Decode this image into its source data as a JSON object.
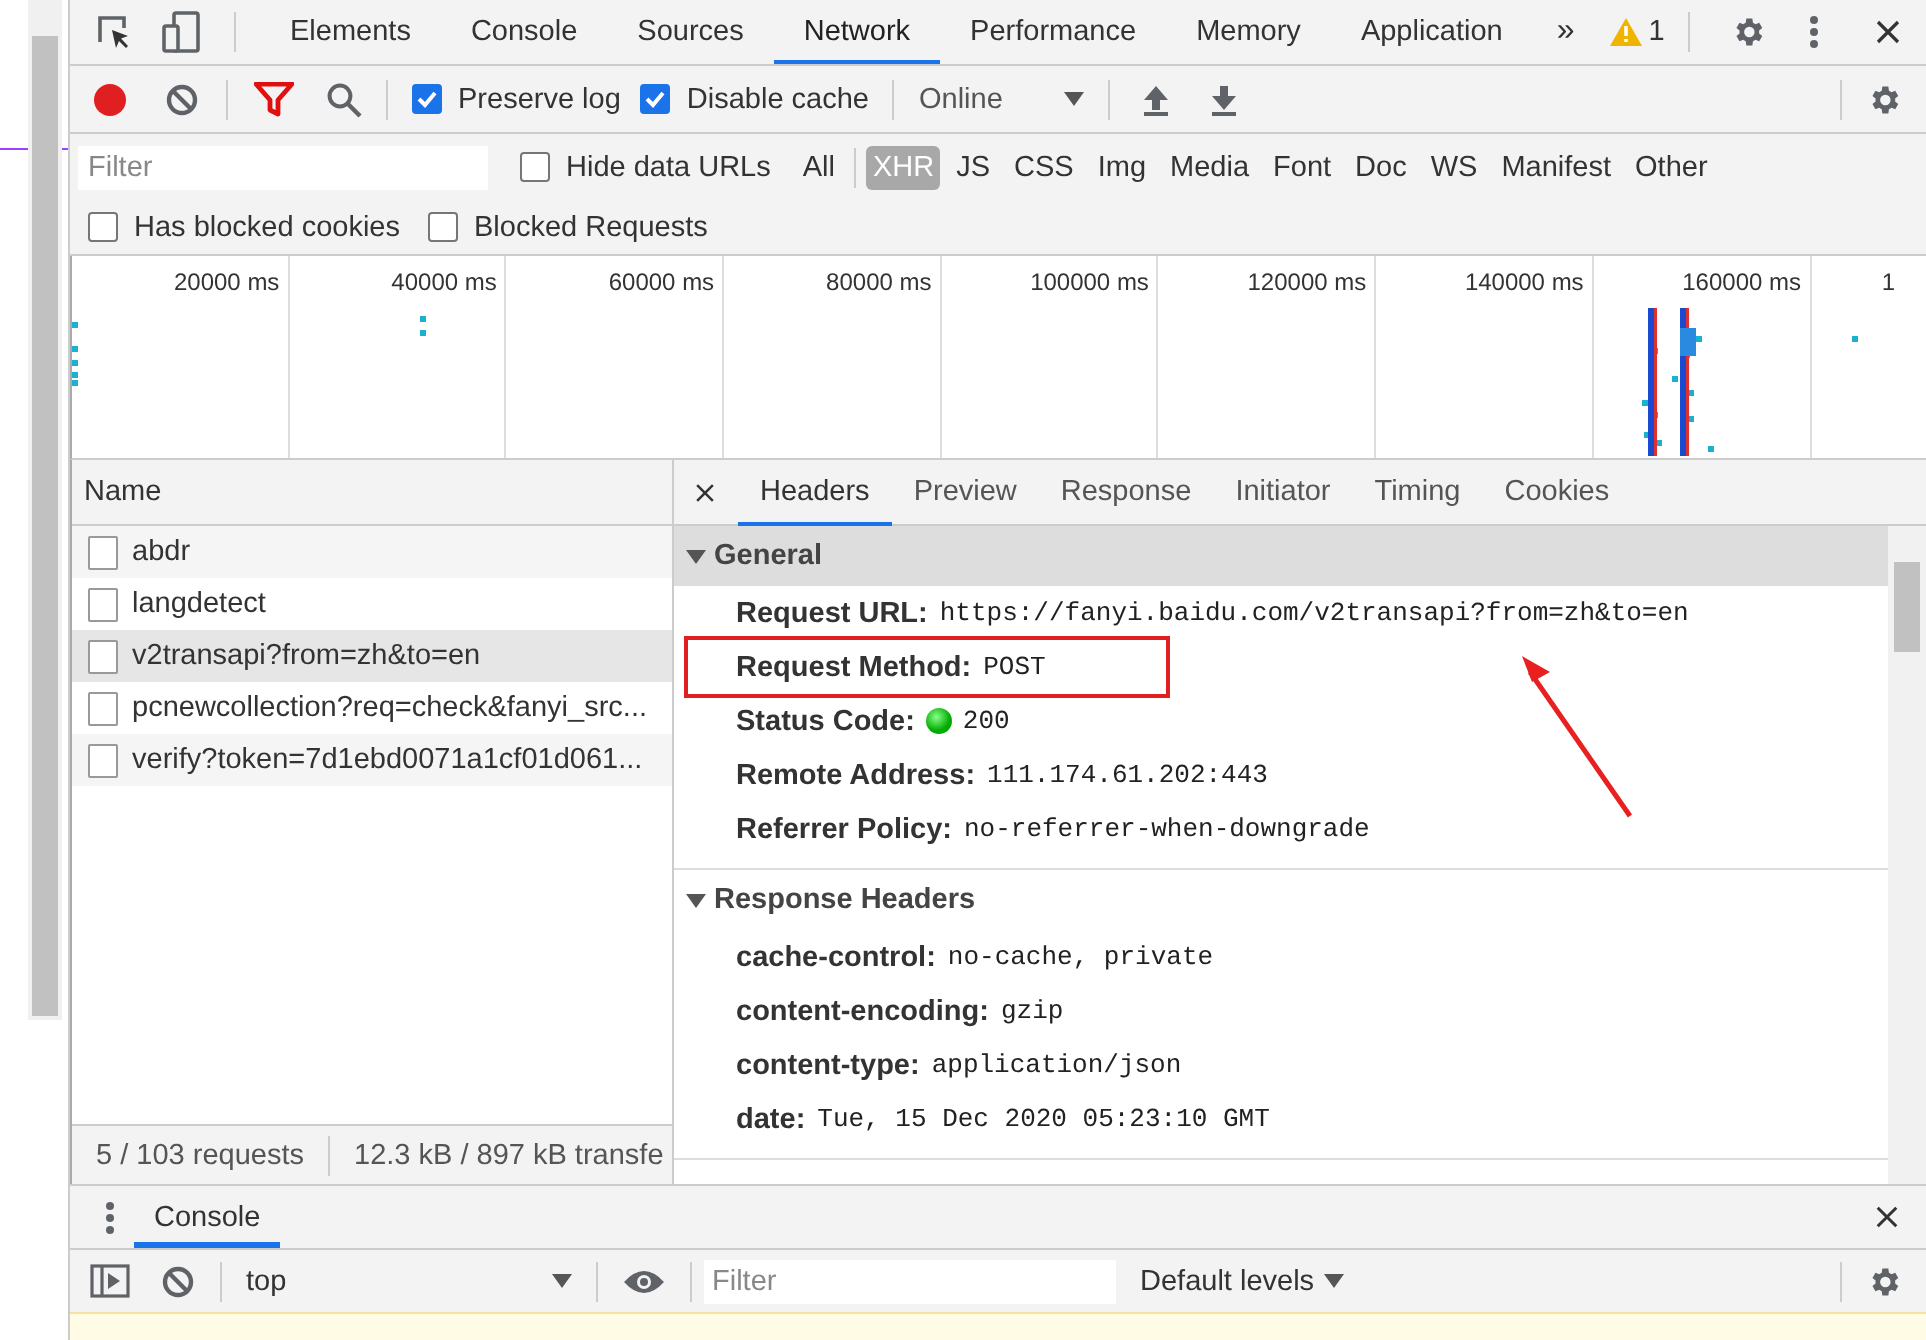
{
  "devtools_tabs": [
    {
      "label": "Elements",
      "selected": false
    },
    {
      "label": "Console",
      "selected": false
    },
    {
      "label": "Sources",
      "selected": false
    },
    {
      "label": "Network",
      "selected": true
    },
    {
      "label": "Performance",
      "selected": false
    },
    {
      "label": "Memory",
      "selected": false
    },
    {
      "label": "Application",
      "selected": false
    }
  ],
  "overflow_tabs": "»",
  "issues": {
    "count": "1"
  },
  "network_toolbar": {
    "recording": true,
    "filter_active": true,
    "options": [
      {
        "label": "Preserve log",
        "checked": true
      },
      {
        "label": "Disable cache",
        "checked": true
      }
    ],
    "throttling": "Online"
  },
  "filter_bar": {
    "placeholder": "Filter",
    "hide_data_urls": {
      "label": "Hide data URLs",
      "checked": false
    },
    "types": [
      {
        "label": "All",
        "selected": false
      },
      {
        "label": "XHR",
        "selected": true
      },
      {
        "label": "JS",
        "selected": false
      },
      {
        "label": "CSS",
        "selected": false
      },
      {
        "label": "Img",
        "selected": false
      },
      {
        "label": "Media",
        "selected": false
      },
      {
        "label": "Font",
        "selected": false
      },
      {
        "label": "Doc",
        "selected": false
      },
      {
        "label": "WS",
        "selected": false
      },
      {
        "label": "Manifest",
        "selected": false
      },
      {
        "label": "Other",
        "selected": false
      }
    ]
  },
  "blocked_filters": [
    {
      "label": "Has blocked cookies",
      "checked": false
    },
    {
      "label": "Blocked Requests",
      "checked": false
    }
  ],
  "overview": {
    "ticks": [
      "20000 ms",
      "40000 ms",
      "60000 ms",
      "80000 ms",
      "100000 ms",
      "120000 ms",
      "140000 ms",
      "160000 ms",
      "1"
    ]
  },
  "requests": {
    "column": "Name",
    "rows": [
      {
        "name": "abdr",
        "selected": false
      },
      {
        "name": "langdetect",
        "selected": false
      },
      {
        "name": "v2transapi?from=zh&to=en",
        "selected": true
      },
      {
        "name": "pcnewcollection?req=check&fanyi_src...",
        "selected": false
      },
      {
        "name": "verify?token=7d1ebd0071a1cf01d061...",
        "selected": false
      }
    ]
  },
  "status_bar": [
    "5 / 103 requests",
    "12.3 kB / 897 kB transfe"
  ],
  "details": {
    "tabs": [
      {
        "label": "Headers",
        "selected": true
      },
      {
        "label": "Preview",
        "selected": false
      },
      {
        "label": "Response",
        "selected": false
      },
      {
        "label": "Initiator",
        "selected": false
      },
      {
        "label": "Timing",
        "selected": false
      },
      {
        "label": "Cookies",
        "selected": false
      }
    ],
    "sections": [
      {
        "title": "General",
        "expanded": true,
        "rows": [
          {
            "kind": "field",
            "key": "Request URL:",
            "value": "https://fanyi.baidu.com/v2transapi?from=zh&to=en",
            "highlighted": false
          },
          {
            "kind": "field",
            "key": "Request Method:",
            "value": "POST",
            "highlighted": true
          },
          {
            "kind": "status",
            "key": "Status Code:",
            "value": "200",
            "highlighted": false
          },
          {
            "kind": "field",
            "key": "Remote Address:",
            "value": "111.174.61.202:443",
            "highlighted": false
          },
          {
            "kind": "field",
            "key": "Referrer Policy:",
            "value": "no-referrer-when-downgrade",
            "highlighted": false
          }
        ]
      },
      {
        "title": "Response Headers",
        "expanded": true,
        "rows": [
          {
            "kind": "field",
            "key": "cache-control:",
            "value": "no-cache, private",
            "highlighted": false
          },
          {
            "kind": "field",
            "key": "content-encoding:",
            "value": "gzip",
            "highlighted": false
          },
          {
            "kind": "field",
            "key": "content-type:",
            "value": "application/json",
            "highlighted": false
          },
          {
            "kind": "field",
            "key": "date:",
            "value": "Tue, 15 Dec 2020 05:23:10 GMT",
            "highlighted": false
          }
        ]
      }
    ]
  },
  "drawer": {
    "tabs": [
      {
        "label": "Console",
        "selected": true
      }
    ],
    "context": "top",
    "filter_placeholder": "Filter",
    "levels": "Default levels"
  }
}
